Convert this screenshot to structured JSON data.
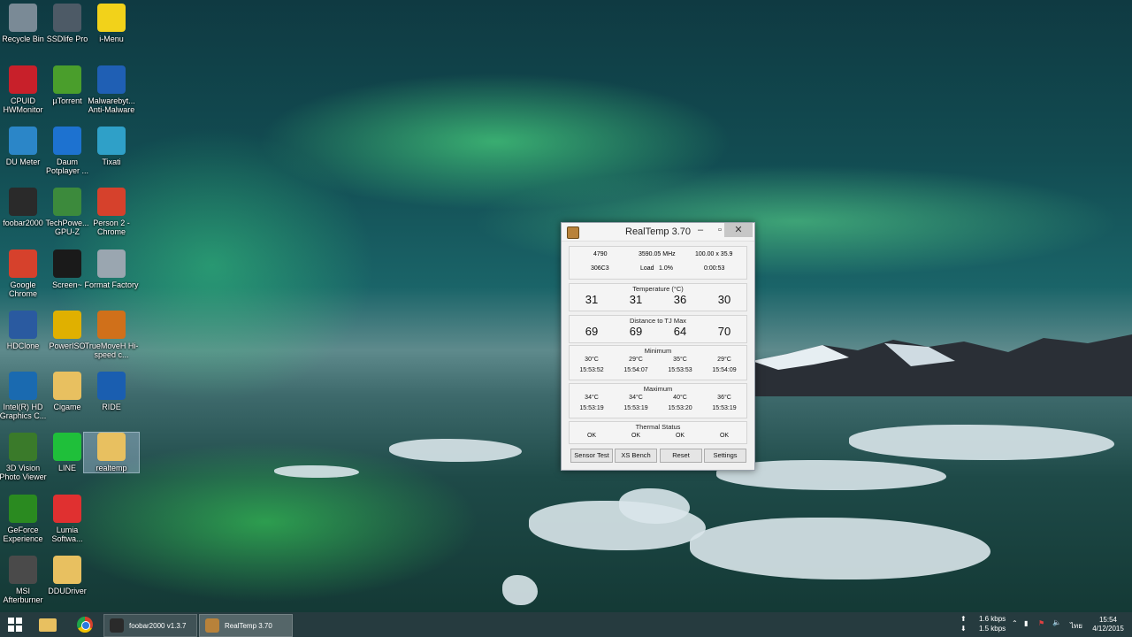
{
  "desktop_icons": [
    {
      "label": "Recycle Bin",
      "icon": "recycle-bin-icon",
      "color": "#7a8a96"
    },
    {
      "label": "SSDlife Pro",
      "icon": "ssd-icon",
      "color": "#4d5a66"
    },
    {
      "label": "i-Menu",
      "icon": "smiley-icon",
      "color": "#f2d21a"
    },
    {
      "label": "CPUID HWMonitor",
      "icon": "hwmonitor-icon",
      "color": "#c8202a"
    },
    {
      "label": "µTorrent",
      "icon": "utorrent-icon",
      "color": "#4a9e2c"
    },
    {
      "label": "Malwarebyt... Anti-Malware",
      "icon": "malwarebytes-icon",
      "color": "#1f5fb4"
    },
    {
      "label": "DU Meter",
      "icon": "du-meter-icon",
      "color": "#2b86c8"
    },
    {
      "label": "Daum Potplayer ...",
      "icon": "potplayer-icon",
      "color": "#1d72d0"
    },
    {
      "label": "Tixati",
      "icon": "tixati-icon",
      "color": "#2fa0c8"
    },
    {
      "label": "foobar2000",
      "icon": "foobar-icon",
      "color": "#2a2a2a"
    },
    {
      "label": "TechPowe... GPU-Z",
      "icon": "gpuz-icon",
      "color": "#3c8a3c"
    },
    {
      "label": "Person 2 - Chrome",
      "icon": "chrome-icon",
      "color": "#d6412c"
    },
    {
      "label": "Google Chrome",
      "icon": "chrome-icon",
      "color": "#d6412c"
    },
    {
      "label": "Screen~",
      "icon": "screen-icon",
      "color": "#1a1a1a"
    },
    {
      "label": "Format Factory",
      "icon": "format-factory-icon",
      "color": "#9aa6b0"
    },
    {
      "label": "HDClone",
      "icon": "hdclone-icon",
      "color": "#2a5aa0"
    },
    {
      "label": "PowerISO",
      "icon": "poweriso-icon",
      "color": "#e0b000"
    },
    {
      "label": "TrueMoveH Hi-speed c...",
      "icon": "truemove-icon",
      "color": "#d0701a"
    },
    {
      "label": "Intel(R) HD Graphics C...",
      "icon": "intel-icon",
      "color": "#1a6ab0"
    },
    {
      "label": "Cigame",
      "icon": "folder-icon",
      "color": "#e8c060"
    },
    {
      "label": "RIDE",
      "icon": "ride-icon",
      "color": "#1a5eb0"
    },
    {
      "label": "3D Vision Photo Viewer",
      "icon": "3d-vision-icon",
      "color": "#3a7a2a"
    },
    {
      "label": "LINE",
      "icon": "line-icon",
      "color": "#1fbf3a"
    },
    {
      "label": "realtemp",
      "icon": "folder-icon",
      "color": "#e8c060"
    },
    {
      "label": "GeForce Experience",
      "icon": "geforce-icon",
      "color": "#2a8a20"
    },
    {
      "label": "Lumia Softwa...",
      "icon": "lumia-icon",
      "color": "#e03030"
    },
    {
      "label": "MSI Afterburner",
      "icon": "afterburner-icon",
      "color": "#4a4a4a"
    },
    {
      "label": "DDUDriver",
      "icon": "folder-icon",
      "color": "#e8c060"
    }
  ],
  "realtemp": {
    "title": "RealTemp 3.70",
    "cpu": "4790",
    "mhz": "3590.05 MHz",
    "multiplier": "100.00 x 35.9",
    "cpuid": "306C3",
    "load_label": "Load",
    "load_value": "1.0%",
    "uptime": "0:00:53",
    "temperature_label": "Temperature (°C)",
    "temps": [
      "31",
      "31",
      "36",
      "30"
    ],
    "distance_label": "Distance to TJ Max",
    "distance": [
      "69",
      "69",
      "64",
      "70"
    ],
    "minimum_label": "Minimum",
    "min_temps": [
      "30°C",
      "29°C",
      "35°C",
      "29°C"
    ],
    "min_times": [
      "15:53:52",
      "15:54:07",
      "15:53:53",
      "15:54:09"
    ],
    "maximum_label": "Maximum",
    "max_temps": [
      "34°C",
      "34°C",
      "40°C",
      "36°C"
    ],
    "max_times": [
      "15:53:19",
      "15:53:19",
      "15:53:20",
      "15:53:19"
    ],
    "thermal_label": "Thermal Status",
    "thermal": [
      "OK",
      "OK",
      "OK",
      "OK"
    ],
    "buttons": [
      "Sensor Test",
      "XS Bench",
      "Reset",
      "Settings"
    ]
  },
  "taskbar": {
    "tasks": [
      "foobar2000 v1.3.7",
      "RealTemp 3.70"
    ],
    "upload": "1.6 kbps",
    "download": "1.5 kbps",
    "language": "ไทย",
    "time": "15:54",
    "date": "4/12/2015"
  }
}
